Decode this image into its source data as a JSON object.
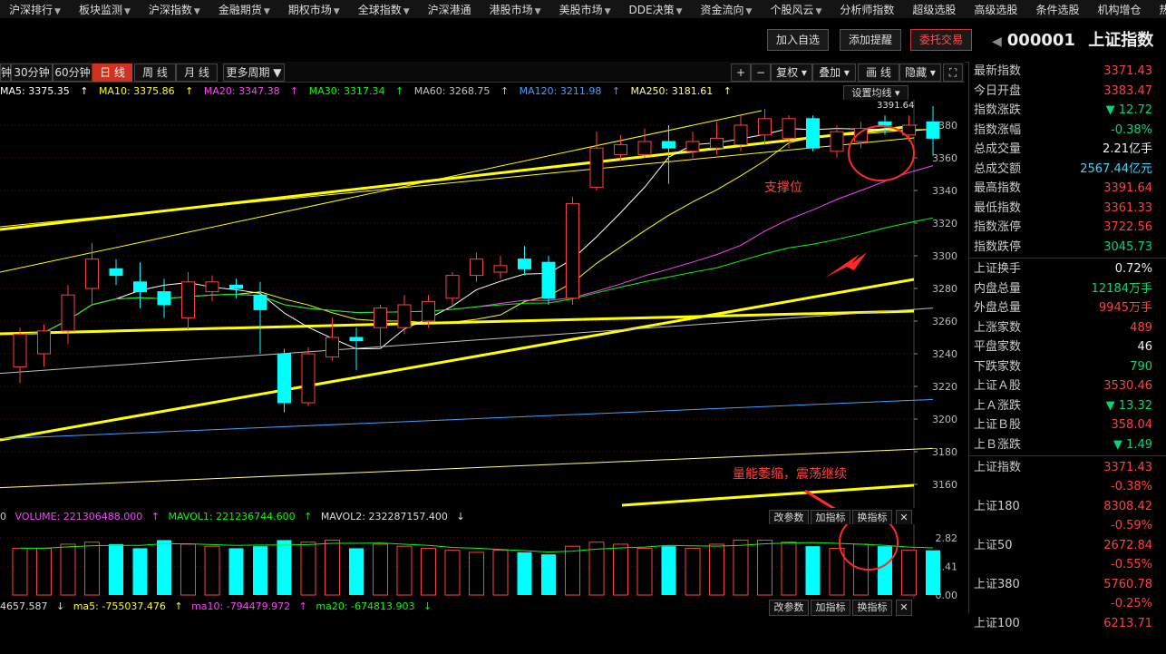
{
  "nav": [
    "沪深排行",
    "板块监测",
    "沪深指数",
    "金融期货",
    "期权市场",
    "全球指数",
    "沪深港通",
    "港股市场",
    "美股市场",
    "DDE决策",
    "资金流向",
    "个股风云",
    "分析师指数",
    "超级选股",
    "高级选股",
    "条件选股",
    "机构增仓",
    "热点"
  ],
  "nav_has_dropdown": [
    true,
    true,
    true,
    true,
    true,
    true,
    false,
    true,
    true,
    true,
    true,
    true,
    false,
    false,
    false,
    false,
    false,
    false
  ],
  "actions": {
    "add_watch": "加入自选",
    "add_alert": "添加提醒",
    "trade": "委托交易"
  },
  "stock": {
    "code": "000001",
    "name": "上证指数"
  },
  "periods": [
    "钟",
    "30分钟",
    "60分钟",
    "日 线",
    "周 线",
    "月 线",
    "更多周期"
  ],
  "active_period": "日 线",
  "tools": [
    "+",
    "−",
    "复权",
    "叠加",
    "画 线",
    "隐藏"
  ],
  "ma": {
    "ma5": "MA5: 3375.35",
    "ma10": "MA10: 3375.86",
    "ma20": "MA20: 3347.38",
    "ma30": "MA30: 3317.34",
    "ma60": "MA60: 3268.75",
    "ma120": "MA120: 3211.98",
    "ma250": "MA250: 3181.61",
    "setting": "设置均线"
  },
  "colors": {
    "up": "#ff4040",
    "down": "#00ffff",
    "ma5": "#ffffff",
    "ma10": "#ffff00",
    "ma20": "#ff40ff",
    "ma30": "#00ff00",
    "ma60": "#c0c0c0",
    "ma120": "#40a0ff",
    "ma250": "#ffff80",
    "accent": "#d0321e"
  },
  "annotations": {
    "support": "支撑位",
    "volume_note": "量能萎缩，震荡继续",
    "high_label": "3391.64"
  },
  "chart_data": {
    "type": "candlestick",
    "ylim": [
      3140,
      3400
    ],
    "yticks": [
      3380,
      3360,
      3340,
      3320,
      3300,
      3280,
      3260,
      3240,
      3220,
      3200,
      3180,
      3160
    ],
    "candles": [
      {
        "o": 3232,
        "c": 3252,
        "h": 3256,
        "l": 3222,
        "up": true
      },
      {
        "o": 3240,
        "c": 3254,
        "h": 3258,
        "l": 3232,
        "up": true
      },
      {
        "o": 3254,
        "c": 3276,
        "h": 3282,
        "l": 3246,
        "up": true
      },
      {
        "o": 3280,
        "c": 3298,
        "h": 3308,
        "l": 3270,
        "up": true
      },
      {
        "o": 3292,
        "c": 3288,
        "h": 3298,
        "l": 3282,
        "up": false
      },
      {
        "o": 3284,
        "c": 3278,
        "h": 3296,
        "l": 3268,
        "up": false
      },
      {
        "o": 3278,
        "c": 3270,
        "h": 3286,
        "l": 3262,
        "up": false
      },
      {
        "o": 3262,
        "c": 3284,
        "h": 3290,
        "l": 3255,
        "up": true
      },
      {
        "o": 3278,
        "c": 3284,
        "h": 3288,
        "l": 3272,
        "up": true
      },
      {
        "o": 3282,
        "c": 3280,
        "h": 3286,
        "l": 3274,
        "up": false
      },
      {
        "o": 3276,
        "c": 3267,
        "h": 3284,
        "l": 3240,
        "up": false
      },
      {
        "o": 3240,
        "c": 3210,
        "h": 3243,
        "l": 3204,
        "up": false
      },
      {
        "o": 3210,
        "c": 3240,
        "h": 3244,
        "l": 3208,
        "up": true
      },
      {
        "o": 3238,
        "c": 3250,
        "h": 3262,
        "l": 3236,
        "up": true
      },
      {
        "o": 3250,
        "c": 3248,
        "h": 3256,
        "l": 3230,
        "up": false
      },
      {
        "o": 3256,
        "c": 3268,
        "h": 3270,
        "l": 3244,
        "up": true
      },
      {
        "o": 3256,
        "c": 3270,
        "h": 3276,
        "l": 3252,
        "up": true
      },
      {
        "o": 3260,
        "c": 3272,
        "h": 3276,
        "l": 3256,
        "up": true
      },
      {
        "o": 3274,
        "c": 3288,
        "h": 3290,
        "l": 3270,
        "up": true
      },
      {
        "o": 3288,
        "c": 3298,
        "h": 3302,
        "l": 3284,
        "up": true
      },
      {
        "o": 3290,
        "c": 3294,
        "h": 3300,
        "l": 3286,
        "up": true
      },
      {
        "o": 3298,
        "c": 3292,
        "h": 3306,
        "l": 3288,
        "up": false
      },
      {
        "o": 3296,
        "c": 3274,
        "h": 3300,
        "l": 3270,
        "up": false
      },
      {
        "o": 3274,
        "c": 3332,
        "h": 3336,
        "l": 3270,
        "up": true
      },
      {
        "o": 3342,
        "c": 3366,
        "h": 3376,
        "l": 3340,
        "up": true
      },
      {
        "o": 3362,
        "c": 3368,
        "h": 3374,
        "l": 3358,
        "up": true
      },
      {
        "o": 3362,
        "c": 3370,
        "h": 3378,
        "l": 3360,
        "up": true
      },
      {
        "o": 3370,
        "c": 3366,
        "h": 3380,
        "l": 3344,
        "up": false
      },
      {
        "o": 3364,
        "c": 3370,
        "h": 3376,
        "l": 3360,
        "up": true
      },
      {
        "o": 3366,
        "c": 3372,
        "h": 3382,
        "l": 3362,
        "up": true
      },
      {
        "o": 3368,
        "c": 3380,
        "h": 3386,
        "l": 3364,
        "up": true
      },
      {
        "o": 3374,
        "c": 3384,
        "h": 3390,
        "l": 3368,
        "up": true
      },
      {
        "o": 3372,
        "c": 3384,
        "h": 3386,
        "l": 3366,
        "up": true
      },
      {
        "o": 3384,
        "c": 3366,
        "h": 3386,
        "l": 3364,
        "up": false
      },
      {
        "o": 3364,
        "c": 3376,
        "h": 3380,
        "l": 3360,
        "up": true
      },
      {
        "o": 3370,
        "c": 3378,
        "h": 3382,
        "l": 3366,
        "up": true
      },
      {
        "o": 3380,
        "c": 3382,
        "h": 3386,
        "l": 3374,
        "up": false
      },
      {
        "o": 3374,
        "c": 3380,
        "h": 3386,
        "l": 3370,
        "up": true
      },
      {
        "o": 3382,
        "c": 3372,
        "h": 3391.64,
        "l": 3361.33,
        "up": false
      }
    ],
    "volume": {
      "label": "VOLUME: 221306488.000",
      "mavol1": "MAVOL1: 221236744.600",
      "mavol2": "MAVOL2: 232287157.400",
      "yticks": [
        "2.82",
        "1.41",
        "0.00"
      ],
      "ylim": [
        0,
        3.3
      ],
      "bars": [
        2.3,
        2.3,
        2.5,
        2.6,
        2.5,
        2.3,
        2.7,
        2.5,
        2.4,
        2.3,
        2.4,
        2.7,
        2.6,
        2.7,
        2.3,
        2.5,
        2.4,
        2.3,
        2.2,
        2.1,
        2.2,
        2.1,
        2.0,
        2.4,
        2.6,
        2.5,
        2.3,
        2.4,
        2.3,
        2.5,
        2.7,
        2.7,
        2.6,
        2.4,
        2.3,
        2.5,
        2.4,
        2.2,
        2.2
      ],
      "left_ticks": [
        "0"
      ],
      "buttons": [
        "改参数",
        "加指标",
        "换指标"
      ]
    },
    "indicator": {
      "v1": "4657.587",
      "ma5": "ma5: -755037.476",
      "ma10": "ma10: -794479.972",
      "ma20": "ma20: -674813.903"
    }
  },
  "sidebar": {
    "quote": [
      {
        "label": "最新指数",
        "value": "3371.43",
        "cls": "red"
      },
      {
        "label": "今日开盘",
        "value": "3383.47",
        "cls": "red"
      },
      {
        "label": "指数涨跌",
        "value": "▼ 12.72",
        "cls": "grn"
      },
      {
        "label": "指数涨幅",
        "value": "-0.38%",
        "cls": "grn"
      },
      {
        "label": "总成交量",
        "value": "2.21亿手",
        "cls": "wht"
      },
      {
        "label": "总成交额",
        "value": "2567.44亿元",
        "cls": "cyn"
      },
      {
        "label": "最高指数",
        "value": "3391.64",
        "cls": "red"
      },
      {
        "label": "最低指数",
        "value": "3361.33",
        "cls": "red"
      },
      {
        "label": "指数涨停",
        "value": "3722.56",
        "cls": "red"
      },
      {
        "label": "指数跌停",
        "value": "3045.73",
        "cls": "grn"
      }
    ],
    "stats": [
      {
        "label": "上证换手",
        "value": "0.72%",
        "cls": "wht"
      },
      {
        "label": "内盘总量",
        "value": "12184万手",
        "cls": "grn"
      },
      {
        "label": "外盘总量",
        "value": "9945万手",
        "cls": "red"
      },
      {
        "label": "上涨家数",
        "value": "489",
        "cls": "red"
      },
      {
        "label": "平盘家数",
        "value": "46",
        "cls": "wht"
      },
      {
        "label": "下跌家数",
        "value": "790",
        "cls": "grn"
      },
      {
        "label": "上证Ａ股",
        "value": "3530.46",
        "cls": "red"
      },
      {
        "label": "上Ａ涨跌",
        "value": "▼ 13.32",
        "cls": "grn"
      },
      {
        "label": "上证Ｂ股",
        "value": "358.04",
        "cls": "red"
      },
      {
        "label": "上Ｂ涨跌",
        "value": "▼ 1.49",
        "cls": "grn"
      }
    ],
    "indices": [
      {
        "label": "上证指数",
        "value": "3371.43",
        "pct": "-0.38%"
      },
      {
        "label": "上证180",
        "value": "8308.42",
        "pct": "-0.59%"
      },
      {
        "label": "上证50",
        "value": "2672.84",
        "pct": "-0.55%"
      },
      {
        "label": "上证380",
        "value": "5760.78",
        "pct": "-0.25%"
      },
      {
        "label": "上证100",
        "value": "6213.71",
        "pct": ""
      }
    ]
  }
}
